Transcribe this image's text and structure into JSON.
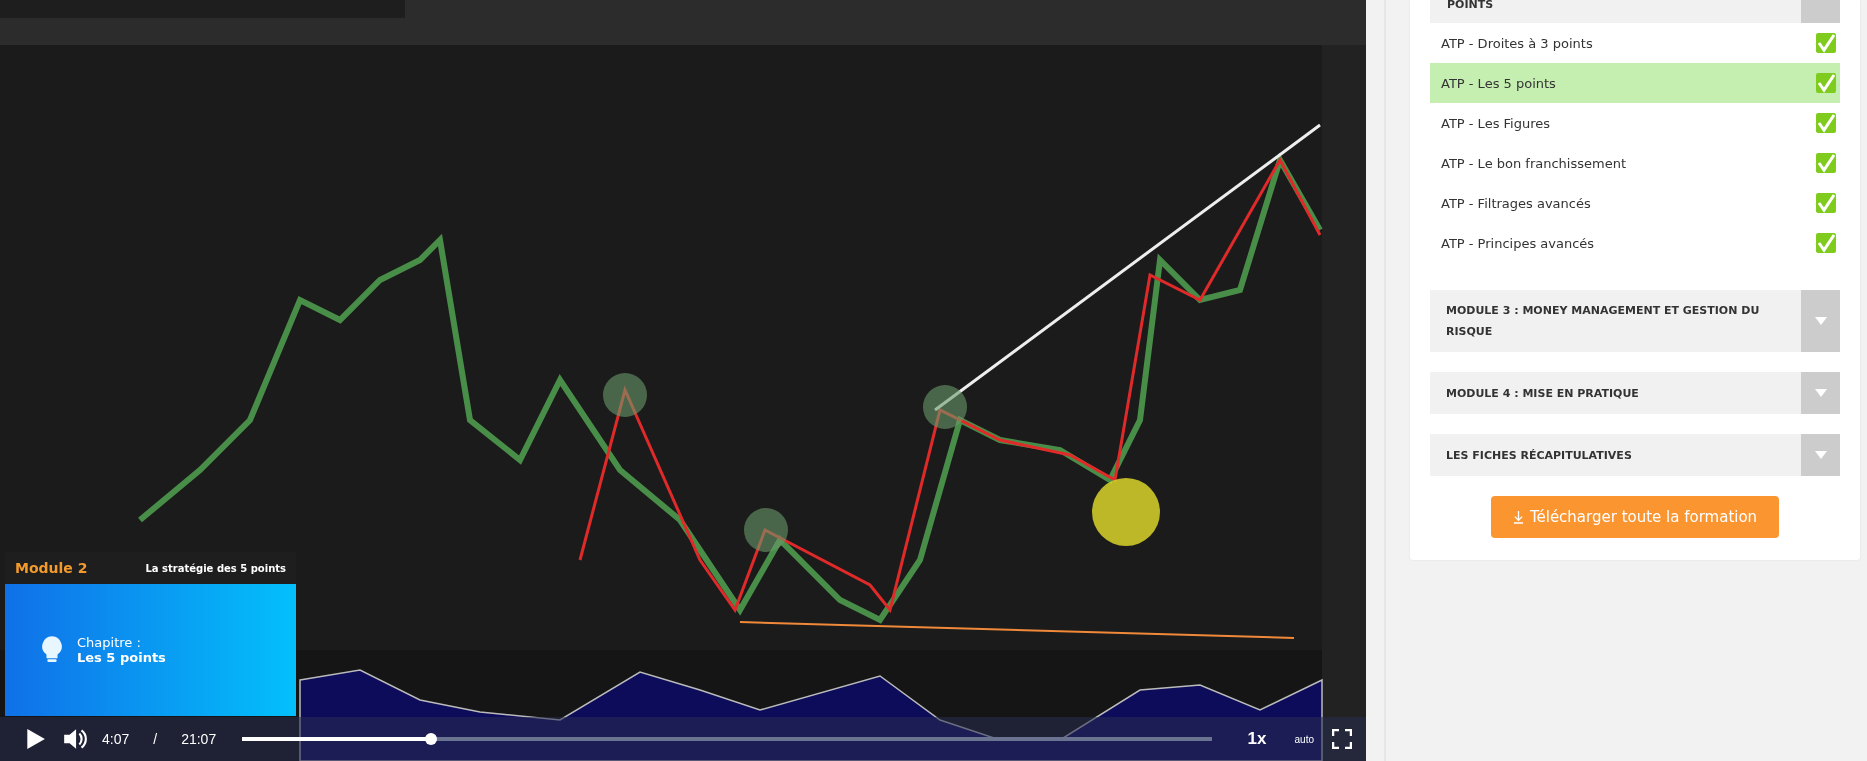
{
  "video": {
    "kind": "picture",
    "overlay": {
      "module": "Module 2",
      "title": "La stratégie des 5 points",
      "chapter_label": "Chapitre :",
      "chapter": "Les 5 points"
    },
    "controls": {
      "playing": false,
      "current_time": "4:07",
      "separator": "/",
      "duration": "21:07",
      "level": 0.195,
      "speed": "1x",
      "quality": "auto"
    }
  },
  "sidebar": {
    "section_header": "POINTS",
    "lessons": [
      {
        "title": "ATP - Droites à 3 points",
        "checked": true,
        "selected": false
      },
      {
        "title": "ATP - Les 5 points",
        "checked": true,
        "selected": true
      },
      {
        "title": "ATP - Les Figures",
        "checked": true,
        "selected": false
      },
      {
        "title": "ATP - Le bon franchissement",
        "checked": true,
        "selected": false
      },
      {
        "title": "ATP - Filtrages avancés",
        "checked": true,
        "selected": false
      },
      {
        "title": "ATP - Principes avancés",
        "checked": true,
        "selected": false
      }
    ],
    "modules": [
      {
        "title": "MODULE 3 : MONEY MANAGEMENT ET GESTION DU RISQUE",
        "expanded": false
      },
      {
        "title": "MODULE 4 : MISE EN PRATIQUE",
        "expanded": false
      },
      {
        "title": "LES FICHES RÉCAPITULATIVES",
        "expanded": false
      }
    ],
    "download_button": "Télécharger toute la formation"
  }
}
